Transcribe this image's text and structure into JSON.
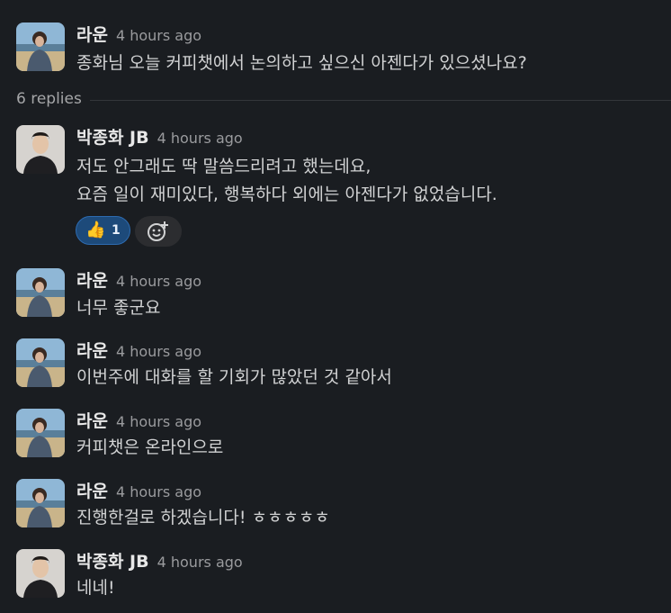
{
  "thread": {
    "root": {
      "author": "라운",
      "time": "4 hours ago",
      "text": "종화님 오늘 커피챗에서 논의하고 싶으신 아젠다가 있으셨나요?"
    },
    "replies_label": "6 replies",
    "replies": [
      {
        "author": "박종화 JB",
        "time": "4 hours ago",
        "lines": [
          "저도 안그래도 딱 말씀드리려고 했는데요,",
          "요즘 일이 재미있다, 행복하다 외에는 아젠다가 없었습니다."
        ],
        "reactions": [
          {
            "emoji": "thumbs-up",
            "count": "1"
          }
        ]
      },
      {
        "author": "라운",
        "time": "4 hours ago",
        "text": "너무 좋군요"
      },
      {
        "author": "라운",
        "time": "4 hours ago",
        "text": "이번주에 대화를 할 기회가 많았던 것 같아서"
      },
      {
        "author": "라운",
        "time": "4 hours ago",
        "text": "커피챗은 온라인으로"
      },
      {
        "author": "라운",
        "time": "4 hours ago",
        "text": "진행한걸로 하겠습니다! ㅎㅎㅎㅎㅎ"
      },
      {
        "author": "박종화 JB",
        "time": "4 hours ago",
        "text": "네네!"
      }
    ]
  },
  "colors": {
    "background": "#1a1d21",
    "reaction_bg": "#1d4a7a",
    "reaction_border": "#2d6bb0"
  },
  "icons": {
    "reaction_emoji": "👍",
    "add_reaction": "add-emoji-icon"
  }
}
